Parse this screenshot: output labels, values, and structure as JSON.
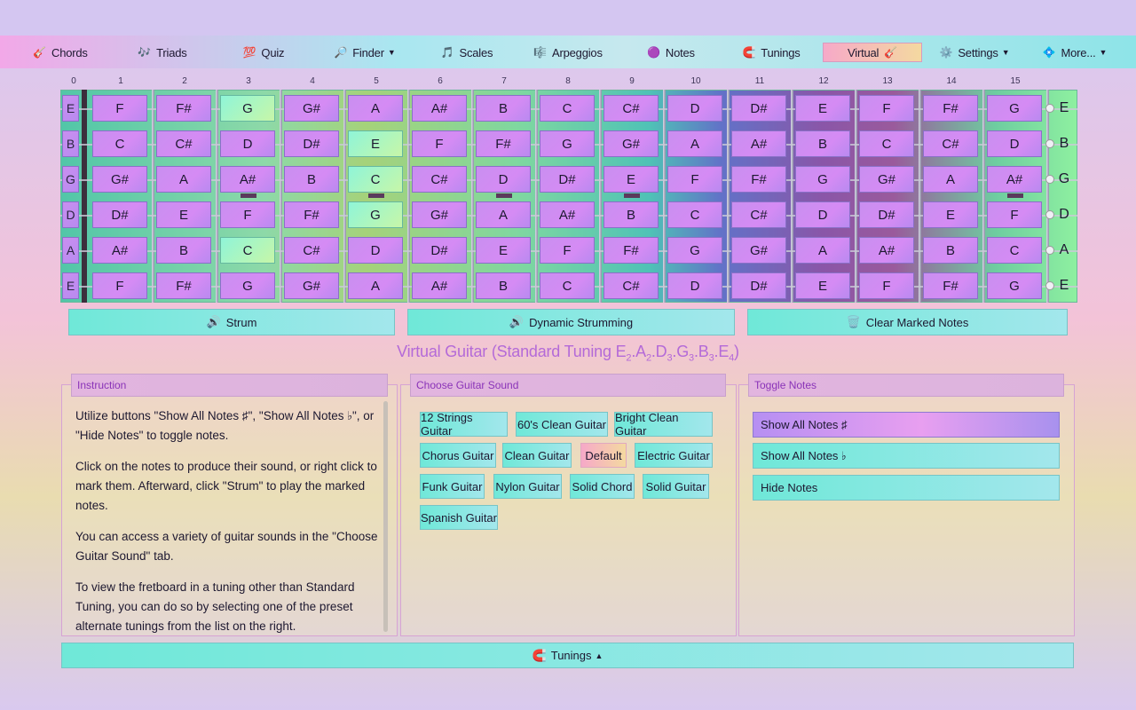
{
  "nav": {
    "items": [
      {
        "icon": "🎸",
        "icon_name": "guitar-icon",
        "label": "Chords",
        "caret": false
      },
      {
        "icon": "🎶",
        "icon_name": "music-notes-icon",
        "label": "Triads",
        "caret": false
      },
      {
        "icon": "💯",
        "icon_name": "hundred-icon",
        "label": "Quiz",
        "caret": false
      },
      {
        "icon": "🔎",
        "icon_name": "magnifier-icon",
        "label": "Finder",
        "caret": true
      },
      {
        "icon": "🎵",
        "icon_name": "music-note-icon",
        "label": "Scales",
        "caret": false
      },
      {
        "icon": "🎼",
        "icon_name": "score-icon",
        "label": "Arpeggios",
        "caret": false
      },
      {
        "icon": "🟣",
        "icon_name": "purple-circle-icon",
        "label": "Notes",
        "caret": false
      },
      {
        "icon": "🧲",
        "icon_name": "magnet-icon",
        "label": "Tunings",
        "caret": false
      },
      {
        "icon": "🎸",
        "icon_name": "guitar-icon",
        "label": "Virtual",
        "caret": false,
        "active": true
      },
      {
        "icon": "⚙️",
        "icon_name": "gear-icon",
        "label": "Settings",
        "caret": true
      },
      {
        "icon": "💠",
        "icon_name": "diamond-icon",
        "label": "More...",
        "caret": true
      }
    ]
  },
  "fretboard": {
    "fret_numbers": [
      "0",
      "1",
      "2",
      "3",
      "4",
      "5",
      "6",
      "7",
      "8",
      "9",
      "10",
      "11",
      "12",
      "13",
      "14",
      "15"
    ],
    "strings": [
      {
        "open": "E",
        "notes": [
          "F",
          "F#",
          "G",
          "G#",
          "A",
          "A#",
          "B",
          "C",
          "C#",
          "D",
          "D#",
          "E",
          "F",
          "F#",
          "G"
        ],
        "highlight": [
          3
        ]
      },
      {
        "open": "B",
        "notes": [
          "C",
          "C#",
          "D",
          "D#",
          "E",
          "F",
          "F#",
          "G",
          "G#",
          "A",
          "A#",
          "B",
          "C",
          "C#",
          "D"
        ],
        "highlight": [
          5
        ]
      },
      {
        "open": "G",
        "notes": [
          "G#",
          "A",
          "A#",
          "B",
          "C",
          "C#",
          "D",
          "D#",
          "E",
          "F",
          "F#",
          "G",
          "G#",
          "A",
          "A#"
        ],
        "highlight": [
          5
        ]
      },
      {
        "open": "D",
        "notes": [
          "D#",
          "E",
          "F",
          "F#",
          "G",
          "G#",
          "A",
          "A#",
          "B",
          "C",
          "C#",
          "D",
          "D#",
          "E",
          "F"
        ],
        "highlight": [
          5
        ]
      },
      {
        "open": "A",
        "notes": [
          "A#",
          "B",
          "C",
          "C#",
          "D",
          "D#",
          "E",
          "F",
          "F#",
          "G",
          "G#",
          "A",
          "A#",
          "B",
          "C"
        ],
        "highlight": [
          3
        ]
      },
      {
        "open": "E",
        "notes": [
          "F",
          "F#",
          "G",
          "G#",
          "A",
          "A#",
          "B",
          "C",
          "C#",
          "D",
          "D#",
          "E",
          "F",
          "F#",
          "G"
        ],
        "highlight": []
      }
    ],
    "right_labels": [
      "E",
      "B",
      "G",
      "D",
      "A",
      "E"
    ]
  },
  "actions": {
    "strum": {
      "icon": "🔊",
      "label": "Strum"
    },
    "dynamic": {
      "icon": "🔊",
      "label": "Dynamic Strumming"
    },
    "clear": {
      "icon": "🗑️",
      "label": "Clear Marked Notes"
    }
  },
  "title_main": "Virtual Guitar (Standard Tuning ",
  "title_notes": [
    {
      "n": "E",
      "o": "2"
    },
    {
      "n": "A",
      "o": "2"
    },
    {
      "n": "D",
      "o": "3"
    },
    {
      "n": "G",
      "o": "3"
    },
    {
      "n": "B",
      "o": "3"
    },
    {
      "n": "E",
      "o": "4"
    }
  ],
  "instruction": {
    "heading": "Instruction",
    "paragraphs": [
      "Utilize buttons \"Show All Notes ♯\", \"Show All Notes ♭\", or \"Hide Notes\" to toggle notes.",
      "Click on the notes to produce their sound, or right click to mark them. Afterward, click \"Strum\" to play the marked notes.",
      "You can access a variety of guitar sounds in the \"Choose Guitar Sound\" tab.",
      "To view the fretboard in a tuning other than Standard Tuning, you can do so by selecting one of the preset alternate tunings from the list on the right."
    ]
  },
  "sound": {
    "heading": "Choose Guitar Sound",
    "buttons": [
      {
        "label": "12 Strings Guitar"
      },
      {
        "label": "60's Clean Guitar"
      },
      {
        "label": "Bright Clean Guitar"
      },
      {
        "label": "Chorus Guitar"
      },
      {
        "label": "Clean Guitar"
      },
      {
        "label": "Default",
        "selected": true
      },
      {
        "label": "Electric Guitar"
      },
      {
        "label": "Funk Guitar"
      },
      {
        "label": "Nylon Guitar"
      },
      {
        "label": "Solid Chord"
      },
      {
        "label": "Solid Guitar"
      },
      {
        "label": "Spanish Guitar"
      }
    ]
  },
  "toggle": {
    "heading": "Toggle Notes",
    "buttons": [
      {
        "label": "Show All Notes ♯",
        "selected": true
      },
      {
        "label": "Show All Notes ♭"
      },
      {
        "label": "Hide Notes"
      }
    ]
  },
  "bottom": {
    "icon": "🧲",
    "label": "Tunings"
  },
  "colors": {
    "accent_title": "#b46ad8",
    "note_fill": "#d58bf4",
    "note_highlight": "#8ff5d8",
    "button_fill": "#6fe8d8",
    "selected_fill": "#f6a9c8"
  }
}
